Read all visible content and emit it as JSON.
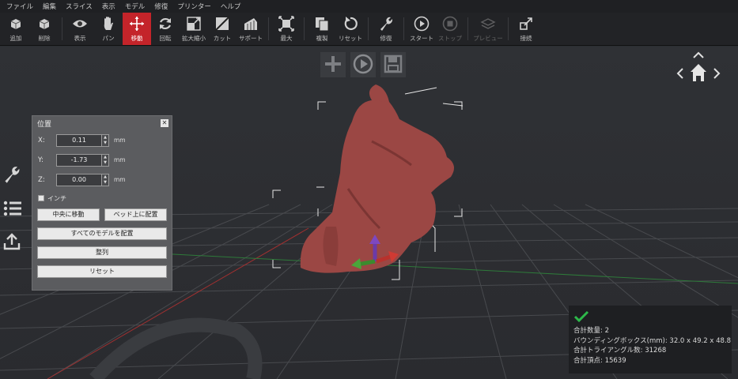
{
  "menu": [
    "ファイル",
    "編集",
    "スライス",
    "表示",
    "モデル",
    "修復",
    "プリンター",
    "ヘルプ"
  ],
  "toolbar": [
    {
      "label": "追加",
      "icon": "add-box-icon",
      "state": "normal"
    },
    {
      "label": "削除",
      "icon": "delete-box-icon",
      "state": "normal"
    },
    {
      "label": "表示",
      "icon": "eye-icon",
      "state": "normal"
    },
    {
      "label": "パン",
      "icon": "hand-icon",
      "state": "normal"
    },
    {
      "label": "移動",
      "icon": "move-arrows-icon",
      "state": "active"
    },
    {
      "label": "回転",
      "icon": "rotate-icon",
      "state": "normal"
    },
    {
      "label": "拡大縮小",
      "icon": "scale-icon",
      "state": "normal"
    },
    {
      "label": "カット",
      "icon": "cut-icon",
      "state": "normal"
    },
    {
      "label": "サポート",
      "icon": "support-icon",
      "state": "normal"
    },
    {
      "label": "最大",
      "icon": "maximize-icon",
      "state": "normal"
    },
    {
      "label": "複製",
      "icon": "duplicate-icon",
      "state": "normal"
    },
    {
      "label": "リセット",
      "icon": "reset-icon",
      "state": "normal"
    },
    {
      "label": "修復",
      "icon": "wrench-icon",
      "state": "normal"
    },
    {
      "label": "スタート",
      "icon": "play-icon",
      "state": "normal"
    },
    {
      "label": "ストップ",
      "icon": "stop-icon",
      "state": "disabled"
    },
    {
      "label": "プレビュー",
      "icon": "preview-icon",
      "state": "disabled"
    },
    {
      "label": "接続",
      "icon": "connect-icon",
      "state": "normal"
    }
  ],
  "panel": {
    "title": "位置",
    "fields": [
      {
        "label": "X:",
        "value": "0.11",
        "unit": "mm"
      },
      {
        "label": "Y:",
        "value": "-1.73",
        "unit": "mm"
      },
      {
        "label": "Z:",
        "value": "0.00",
        "unit": "mm"
      }
    ],
    "inch_label": "インチ",
    "center_button": "中央に移動",
    "bed_button": "ベッド上に配置",
    "arrange_all_button": "すべてのモデルを配置",
    "align_button": "整列",
    "reset_button": "リセット"
  },
  "info": {
    "count": "合計数量: 2",
    "bbox": "バウンディングボックス(mm): 32.0 x 49.2 x 48.8",
    "triangles": "合計トライアングル数: 31268",
    "vertices": "合計頂点: 15639"
  },
  "colors": {
    "accent": "#c4242a",
    "model": "#9b4744",
    "ok": "#2db84a"
  }
}
